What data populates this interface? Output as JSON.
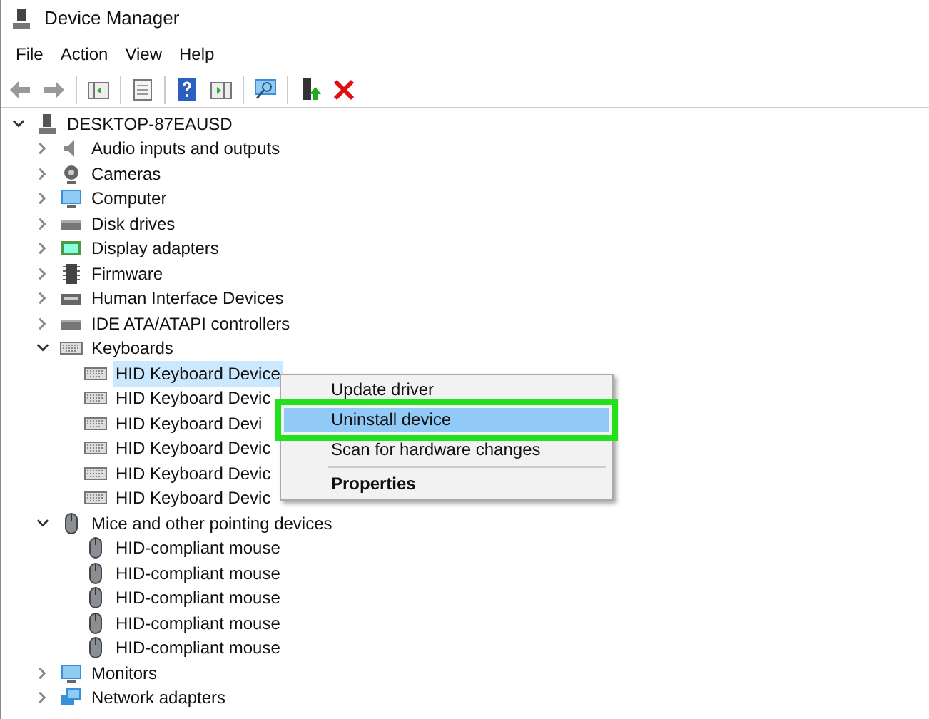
{
  "window": {
    "title": "Device Manager"
  },
  "menu": [
    "File",
    "Action",
    "View",
    "Help"
  ],
  "tree": {
    "label": "DESKTOP-87EAUSD",
    "kind": "computer",
    "expanded": true,
    "children": [
      {
        "label": "Audio inputs and outputs",
        "kind": "audio",
        "expanded": false
      },
      {
        "label": "Cameras",
        "kind": "camera",
        "expanded": false
      },
      {
        "label": "Computer",
        "kind": "monitor",
        "expanded": false
      },
      {
        "label": "Disk drives",
        "kind": "disk",
        "expanded": false
      },
      {
        "label": "Display adapters",
        "kind": "display",
        "expanded": false
      },
      {
        "label": "Firmware",
        "kind": "chip",
        "expanded": false
      },
      {
        "label": "Human Interface Devices",
        "kind": "hid",
        "expanded": false
      },
      {
        "label": "IDE ATA/ATAPI controllers",
        "kind": "disk",
        "expanded": false
      },
      {
        "label": "Keyboards",
        "kind": "keyboard",
        "expanded": true,
        "children": [
          {
            "label": "HID Keyboard Device",
            "kind": "keyboard",
            "selected": true
          },
          {
            "label": "HID Keyboard Devic",
            "kind": "keyboard",
            "selected": false
          },
          {
            "label": "HID Keyboard Devi",
            "kind": "keyboard",
            "selected": false
          },
          {
            "label": "HID Keyboard Devic",
            "kind": "keyboard",
            "selected": false
          },
          {
            "label": "HID Keyboard Devic",
            "kind": "keyboard",
            "selected": false
          },
          {
            "label": "HID Keyboard Devic",
            "kind": "keyboard",
            "selected": false
          }
        ]
      },
      {
        "label": "Mice and other pointing devices",
        "kind": "mouse",
        "expanded": true,
        "children": [
          {
            "label": "HID-compliant mouse",
            "kind": "mouse",
            "selected": false
          },
          {
            "label": "HID-compliant mouse",
            "kind": "mouse",
            "selected": false
          },
          {
            "label": "HID-compliant mouse",
            "kind": "mouse",
            "selected": false
          },
          {
            "label": "HID-compliant mouse",
            "kind": "mouse",
            "selected": false
          },
          {
            "label": "HID-compliant mouse",
            "kind": "mouse",
            "selected": false
          }
        ]
      },
      {
        "label": "Monitors",
        "kind": "monitor",
        "expanded": false
      },
      {
        "label": "Network adapters",
        "kind": "network",
        "expanded": false
      }
    ]
  },
  "context_menu": {
    "items": [
      {
        "label": "Update driver",
        "selected": false,
        "default": false,
        "separator_after": false
      },
      {
        "label": "Uninstall device",
        "selected": true,
        "default": false,
        "separator_after": false
      },
      {
        "label": "Scan for hardware changes",
        "selected": false,
        "default": false,
        "separator_after": true
      },
      {
        "label": "Properties",
        "selected": false,
        "default": true,
        "separator_after": false
      }
    ]
  }
}
